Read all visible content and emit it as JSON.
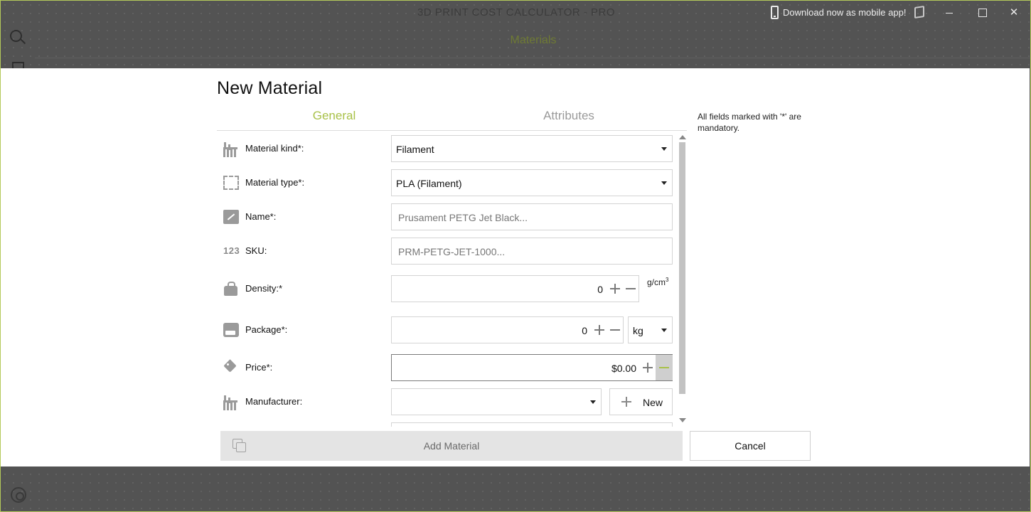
{
  "app": {
    "title": "3D PRINT COST CALCULATOR - PRO",
    "promo": "Download now as mobile app!",
    "close_glyph": "✕",
    "active_tab": "Materials"
  },
  "dialog": {
    "title": "New Material",
    "tabs": [
      "General",
      "Attributes"
    ],
    "hint": "All fields marked with '*' are mandatory.",
    "fields": {
      "material_kind": {
        "label": "Material kind*:",
        "value": "Filament"
      },
      "material_type": {
        "label": "Material type*:",
        "value": "PLA (Filament)"
      },
      "name": {
        "label": "Name*:",
        "placeholder": "Prusament PETG Jet Black..."
      },
      "sku": {
        "label": "SKU:",
        "icon_text": "123",
        "placeholder": "PRM-PETG-JET-1000..."
      },
      "density": {
        "label": "Density:*",
        "value": "0",
        "unit": "g/cm",
        "unit_sup": "3"
      },
      "package": {
        "label": "Package*:",
        "value": "0",
        "unit": "kg"
      },
      "price": {
        "label": "Price*:",
        "value": "$0.00"
      },
      "manufacturer": {
        "label": "Manufacturer:",
        "value": "",
        "new_label": "New"
      }
    },
    "add_label": "Add Material",
    "cancel_label": "Cancel"
  },
  "colors": {
    "accent": "#a8c148",
    "overlay": "#535353"
  }
}
